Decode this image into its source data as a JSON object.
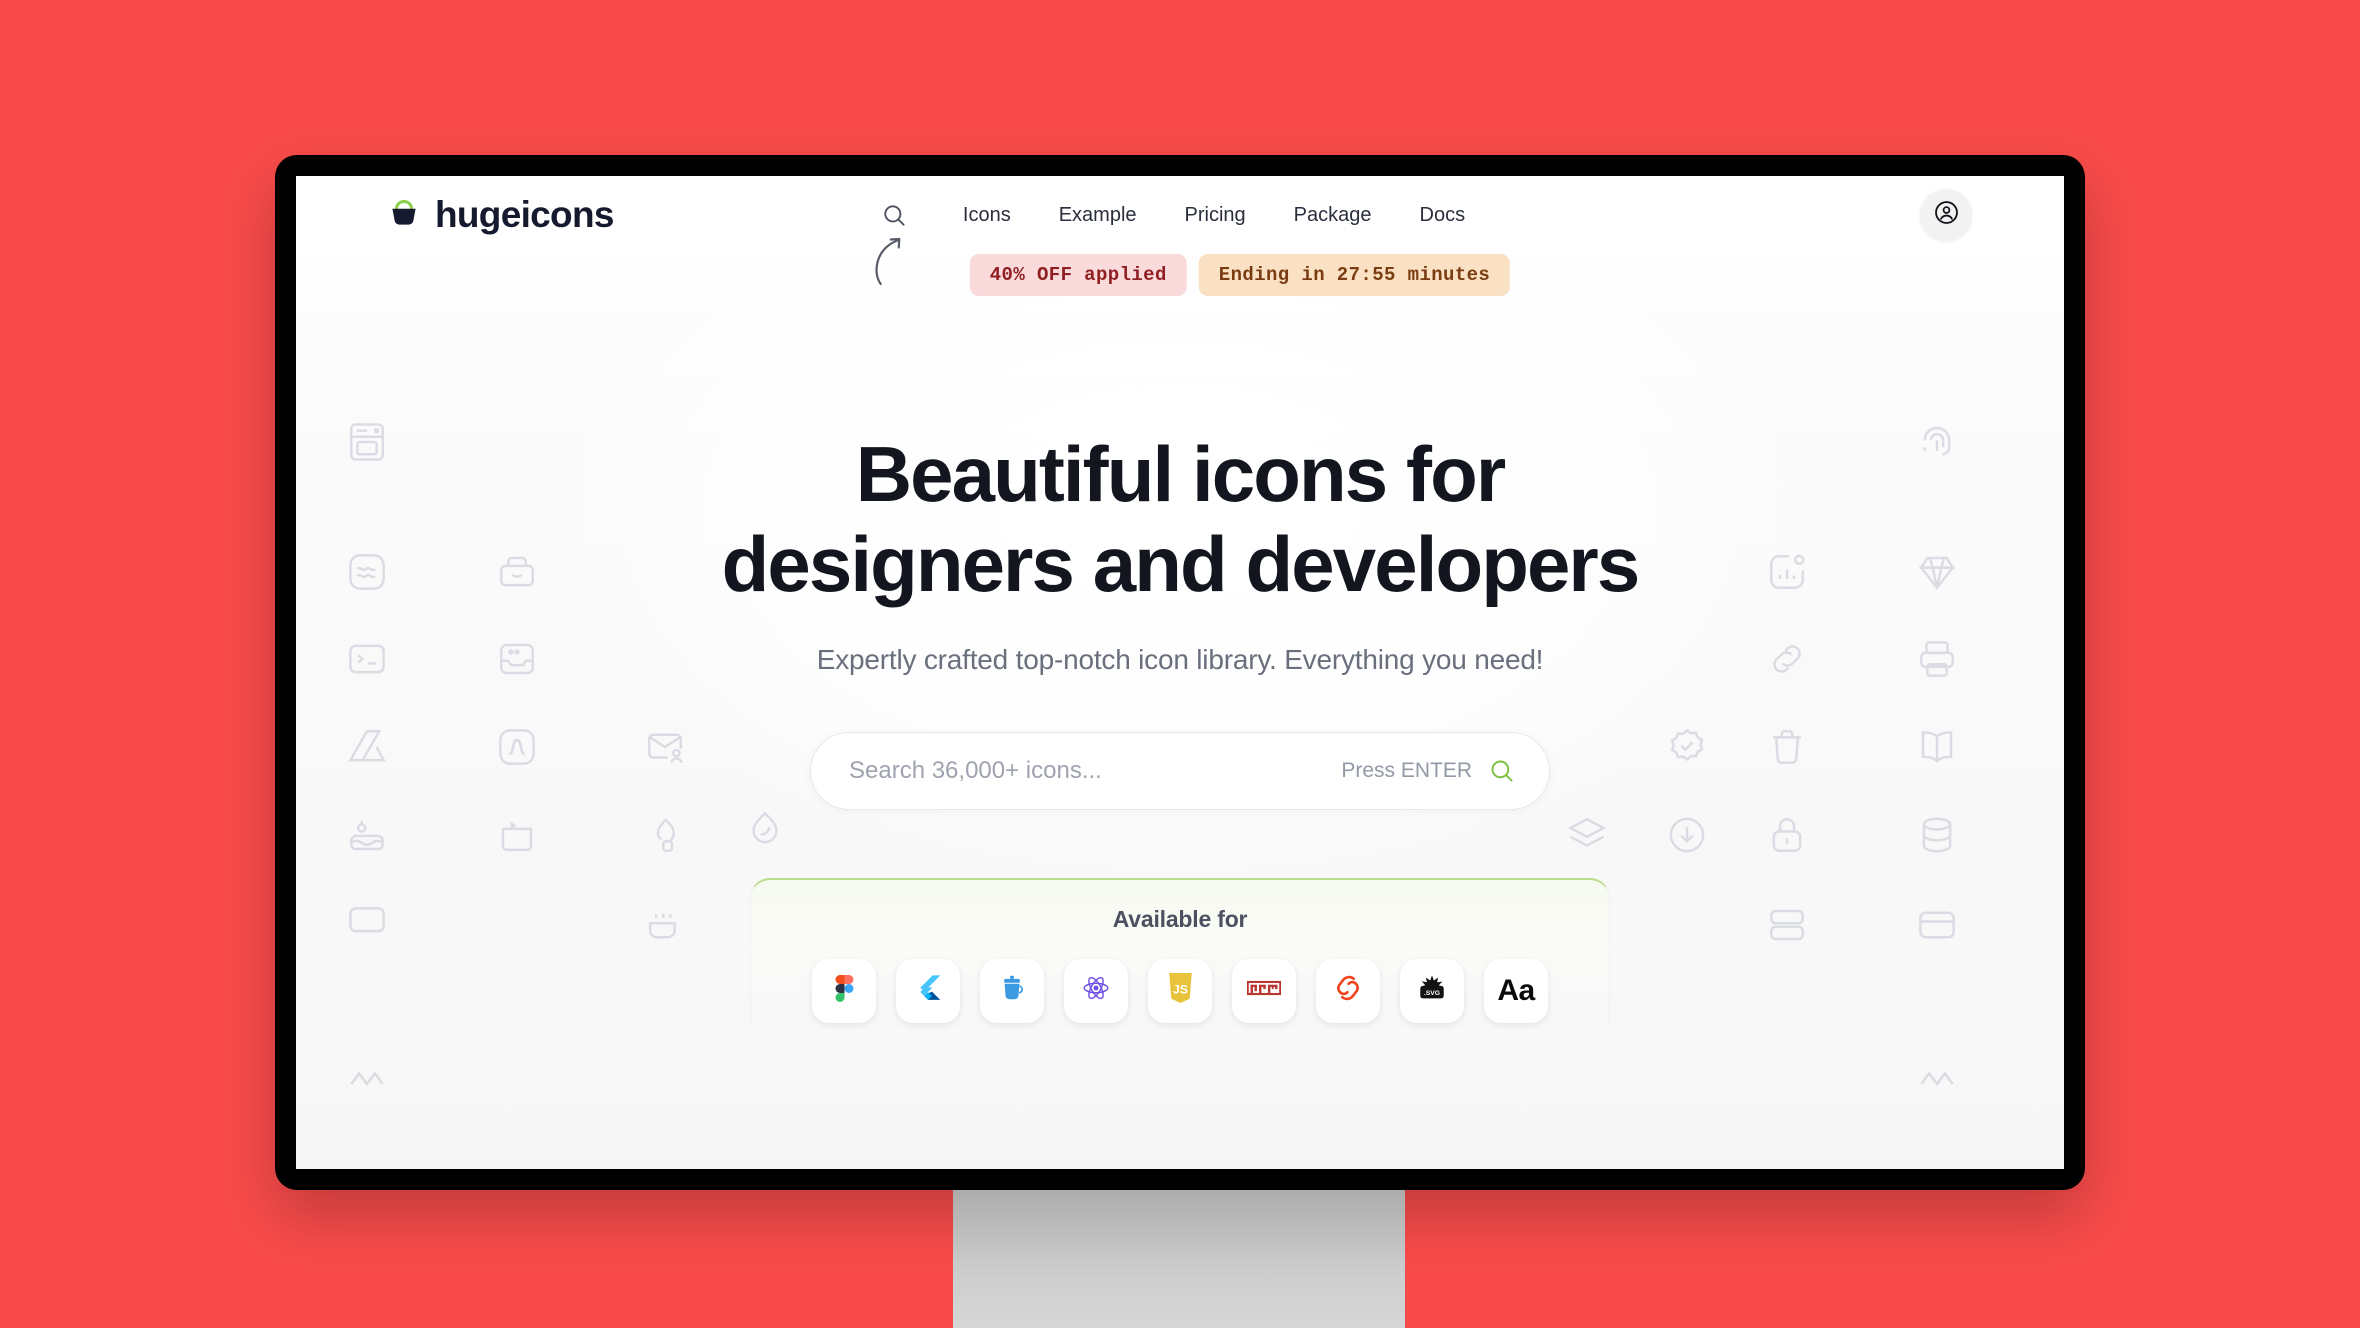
{
  "page": {
    "background_color": "#F94B4B",
    "device": "desktop-monitor"
  },
  "brand": {
    "name": "hugeicons",
    "logo_icon": "bucket-logo-icon",
    "logo_bucket_color": "#161A2E",
    "logo_handle_color": "#8BD04A"
  },
  "nav": {
    "search_icon": "search-icon",
    "links": [
      {
        "label": "Icons"
      },
      {
        "label": "Example"
      },
      {
        "label": "Pricing"
      },
      {
        "label": "Package"
      },
      {
        "label": "Docs"
      }
    ],
    "account_icon": "user-circle-icon"
  },
  "promo": {
    "arrow_icon": "curved-arrow-up-icon",
    "discount_badge": "40% OFF applied",
    "discount_bg": "#FADADA",
    "discount_fg": "#8F1F22",
    "timer_badge": "Ending in 27:55 minutes",
    "timer_bg": "#FBE1C4",
    "timer_fg": "#7A3C12"
  },
  "hero": {
    "headline_line1": "Beautiful icons for",
    "headline_line2": "designers and developers",
    "subtitle": "Expertly crafted top-notch icon library. Everything you need!"
  },
  "search": {
    "value": "",
    "placeholder": "Search 36,000+ icons...",
    "hint": "Press ENTER",
    "submit_icon": "search-icon",
    "submit_icon_color": "#7DC03F"
  },
  "available": {
    "title": "Available for",
    "accent_color": "#B8DC8A",
    "platforms": [
      {
        "name": "Figma",
        "icon": "figma-icon"
      },
      {
        "name": "Flutter",
        "icon": "flutter-icon"
      },
      {
        "name": "Jar",
        "icon": "jar-icon"
      },
      {
        "name": "React",
        "icon": "react-icon"
      },
      {
        "name": "JavaScript",
        "icon": "javascript-icon"
      },
      {
        "name": "npm",
        "icon": "npm-icon"
      },
      {
        "name": "Svelte",
        "icon": "svelte-icon"
      },
      {
        "name": "SVG",
        "icon": "svg-icon"
      },
      {
        "name": "Font",
        "icon": "font-aa-icon",
        "glyph": "Aa"
      }
    ]
  },
  "decor": {
    "watermark_color": "#C9CBD6",
    "icons": [
      "oven-icon",
      "wave-square-icon",
      "terminal-icon",
      "drive-icon",
      "cake-icon",
      "briefcase-icon",
      "inbox-icon",
      "folder-icon",
      "curve-icon",
      "bathtub-icon",
      "mail-user-icon",
      "fire-icon",
      "leaf-drop-icon",
      "chart-icon",
      "diamond-icon",
      "fingerprint-icon",
      "link-icon",
      "badge-check-icon",
      "trash-icon",
      "book-icon",
      "printer-icon",
      "lock-icon",
      "database-icon",
      "layers-icon",
      "download-icon"
    ]
  }
}
